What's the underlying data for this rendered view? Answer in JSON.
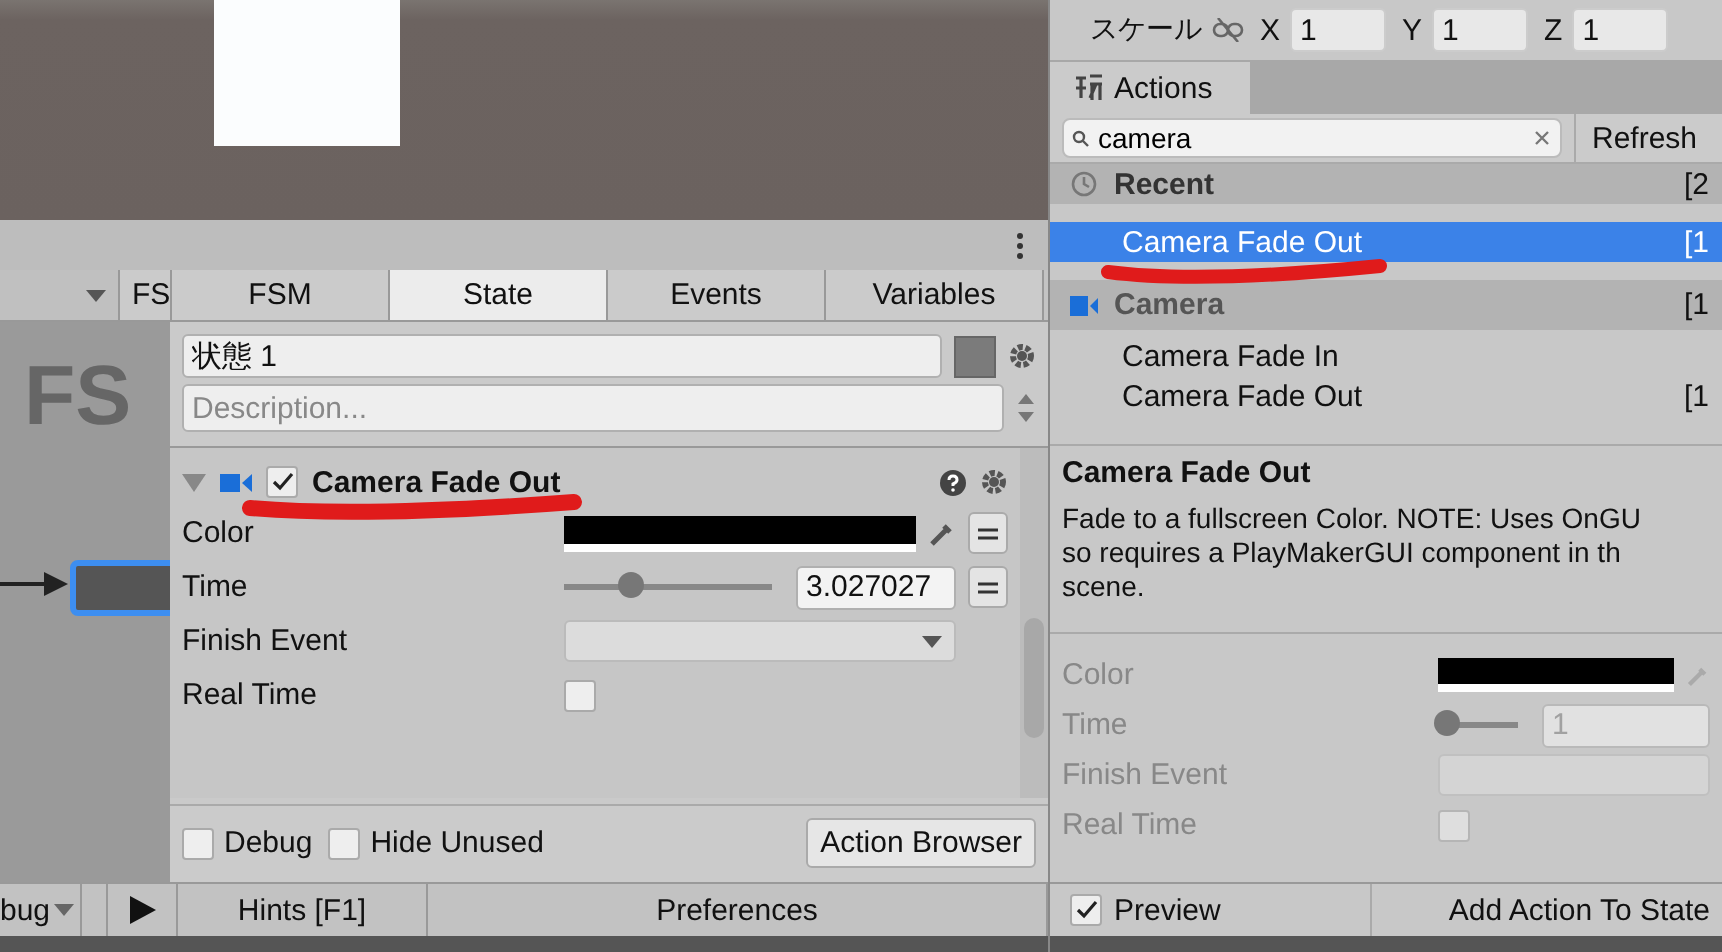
{
  "fsm_editor": {
    "graph_label": "FS",
    "tabs": [
      {
        "label": "FS",
        "selected": false
      },
      {
        "label": "FSM",
        "selected": false
      },
      {
        "label": "State",
        "selected": true
      },
      {
        "label": "Events",
        "selected": false
      },
      {
        "label": "Variables",
        "selected": false
      }
    ],
    "state_name": "状態 1",
    "description": {
      "placeholder": "Description..."
    },
    "action": {
      "title": "Camera Fade Out",
      "expanded": true,
      "enabled": true,
      "params": [
        {
          "kind": "color",
          "label": "Color"
        },
        {
          "kind": "slider",
          "label": "Time",
          "level": 0.32,
          "value": "3.027027"
        },
        {
          "kind": "dropdown",
          "label": "Finish Event"
        },
        {
          "kind": "checkbox",
          "label": "Real Time",
          "checked": false
        }
      ]
    },
    "options": [
      {
        "label": "Debug",
        "checked": false
      },
      {
        "label": "Hide Unused",
        "checked": false
      }
    ],
    "action_browser_button": "Action Browser",
    "toolbar": [
      {
        "kind": "dropdown",
        "label": "bug"
      },
      {
        "kind": "play"
      },
      {
        "kind": "button",
        "label": "Hints [F1]"
      },
      {
        "kind": "button",
        "label": "Preferences"
      }
    ]
  },
  "transform": {
    "label": "スケール",
    "axes": [
      {
        "label": "X",
        "value": "1"
      },
      {
        "label": "Y",
        "value": "1"
      },
      {
        "label": "Z",
        "value": "1"
      }
    ]
  },
  "actions_panel": {
    "tab": "Actions",
    "search": {
      "value": "camera"
    },
    "refresh_button": "Refresh",
    "items": [
      {
        "kind": "recent",
        "label": "Recent",
        "count": "[2",
        "selected": false
      },
      {
        "kind": "action",
        "label": "Camera Fade Out",
        "count": "[1",
        "selected": true
      },
      {
        "kind": "category",
        "label": "Camera",
        "count": "[1",
        "selected": false
      },
      {
        "kind": "action",
        "label": "Camera Fade In",
        "selected": false
      },
      {
        "kind": "action",
        "label": "Camera Fade Out",
        "count": "[1",
        "selected": false
      }
    ],
    "description": {
      "title": "Camera Fade Out",
      "lines": [
        "Fade to a fullscreen Color. NOTE: Uses OnGU",
        "so requires a PlayMakerGUI component in th",
        "scene."
      ]
    },
    "preview_params": [
      {
        "kind": "color",
        "label": "Color"
      },
      {
        "kind": "slider",
        "label": "Time",
        "level": 0.1,
        "value": "1"
      },
      {
        "kind": "dropdown",
        "label": "Finish Event"
      },
      {
        "kind": "checkbox",
        "label": "Real Time",
        "checked": false
      }
    ],
    "preview": {
      "label": "Preview",
      "checked": true
    },
    "add_button": "Add Action To State"
  }
}
